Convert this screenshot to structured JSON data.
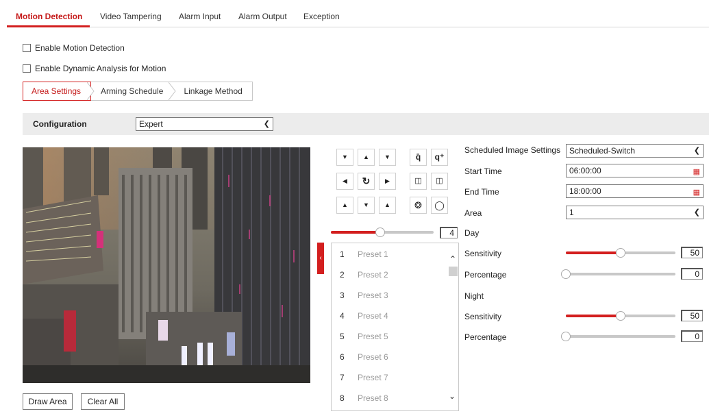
{
  "top_tabs": [
    "Motion Detection",
    "Video Tampering",
    "Alarm Input",
    "Alarm Output",
    "Exception"
  ],
  "checkboxes": {
    "enable_motion": "Enable Motion Detection",
    "enable_dynamic": "Enable Dynamic Analysis for Motion"
  },
  "sub_tabs": [
    "Area Settings",
    "Arming Schedule",
    "Linkage Method"
  ],
  "configuration": {
    "label": "Configuration",
    "value": "Expert"
  },
  "video_buttons": {
    "draw": "Draw Area",
    "clear": "Clear All"
  },
  "ptz": {
    "icons": [
      "arrow-down-right-icon",
      "arrow-up-icon",
      "arrow-down-left-icon",
      "zoom-out-icon",
      "zoom-in-icon",
      "arrow-left-icon",
      "auto-pan-icon",
      "arrow-right-icon",
      "focus-near-icon",
      "focus-far-icon",
      "arrow-up-right-icon",
      "arrow-down-icon",
      "arrow-up-left-icon",
      "iris-open-icon",
      "iris-close-icon"
    ],
    "speed_value": "4",
    "speed_level": 0.48
  },
  "presets": [
    {
      "num": "1",
      "name": "Preset 1"
    },
    {
      "num": "2",
      "name": "Preset 2"
    },
    {
      "num": "3",
      "name": "Preset 3"
    },
    {
      "num": "4",
      "name": "Preset 4"
    },
    {
      "num": "5",
      "name": "Preset 5"
    },
    {
      "num": "6",
      "name": "Preset 6"
    },
    {
      "num": "7",
      "name": "Preset 7"
    },
    {
      "num": "8",
      "name": "Preset 8"
    }
  ],
  "settings": {
    "scheduled_label": "Scheduled Image Settings",
    "scheduled_value": "Scheduled-Switch",
    "start_label": "Start Time",
    "start_value": "06:00:00",
    "end_label": "End Time",
    "end_value": "18:00:00",
    "area_label": "Area",
    "area_value": "1",
    "day_label": "Day",
    "day_sensitivity_label": "Sensitivity",
    "day_sensitivity_value": "50",
    "day_sensitivity_level": 0.5,
    "day_percentage_label": "Percentage",
    "day_percentage_value": "0",
    "day_percentage_level": 0,
    "night_label": "Night",
    "night_sensitivity_label": "Sensitivity",
    "night_sensitivity_value": "50",
    "night_sensitivity_level": 0.5,
    "night_percentage_label": "Percentage",
    "night_percentage_value": "0",
    "night_percentage_level": 0
  },
  "colors": {
    "accent": "#d31f1f"
  }
}
